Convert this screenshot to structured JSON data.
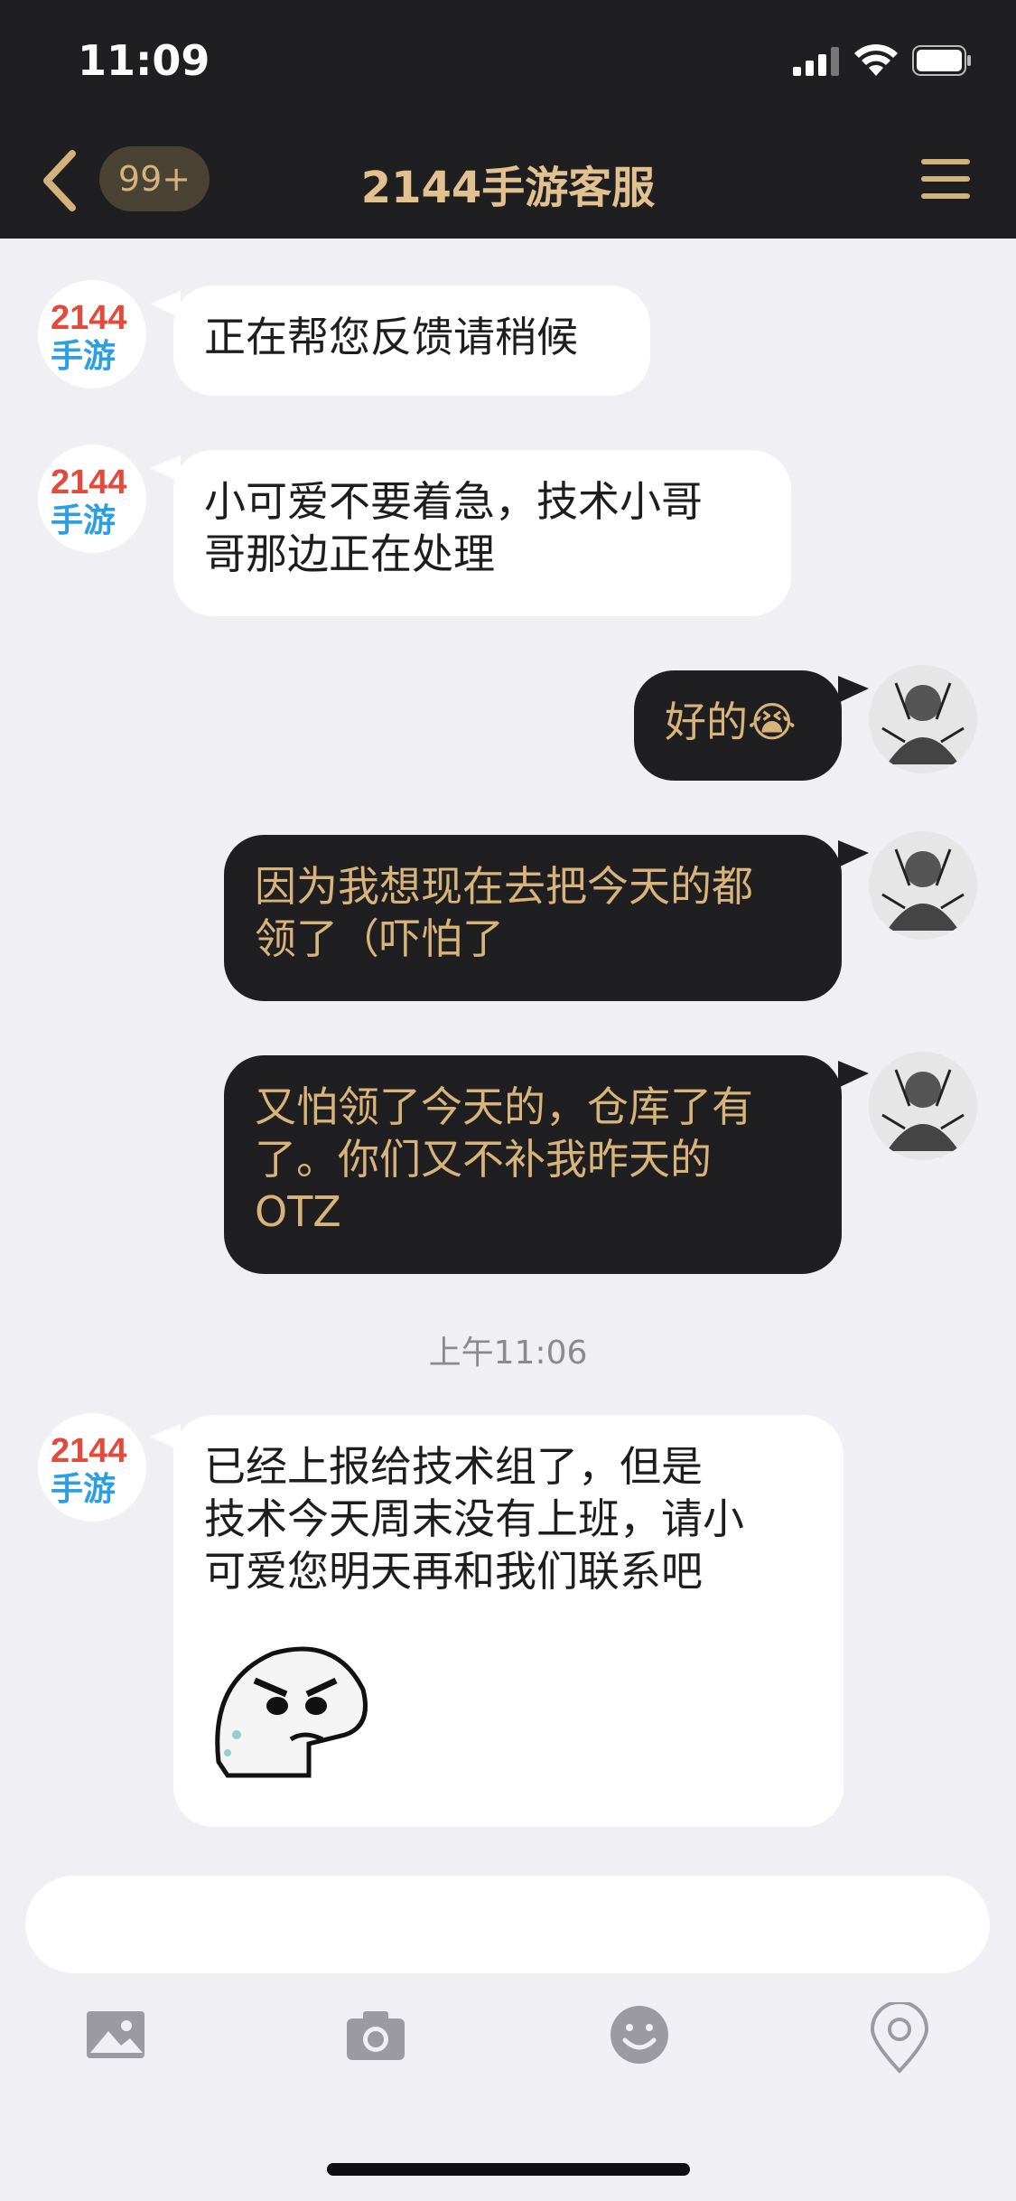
{
  "status_bar": {
    "time": "11:09"
  },
  "nav": {
    "badge": "99+",
    "title": "2144手游客服"
  },
  "brand": {
    "logo_top": "2144",
    "logo_bottom": "手游"
  },
  "messages": [
    {
      "side": "in",
      "text": "正在帮您反馈请稍候"
    },
    {
      "side": "in",
      "text_lines": [
        "小可爱不要着急，技术小哥",
        "哥那边正在处理"
      ]
    },
    {
      "side": "out",
      "text": "好的",
      "emoji": "😭"
    },
    {
      "side": "out",
      "text_lines": [
        "因为我想现在去把今天的都",
        "领了（吓怕了"
      ]
    },
    {
      "side": "out",
      "text_lines": [
        "又怕领了今天的，仓库了有",
        "了。你们又不补我昨天的",
        "OTZ"
      ]
    },
    {
      "side": "in",
      "text_lines": [
        " 已经上报给技术组了，但是",
        "技术今天周末没有上班，请小",
        "可爱您明天再和我们联系吧"
      ],
      "has_sticker": true
    }
  ],
  "timestamp": "上午11:06",
  "input": {
    "value": "",
    "placeholder": ""
  },
  "toolbar": {
    "items": [
      "image-icon",
      "camera-icon",
      "emoji-icon",
      "location-icon"
    ]
  },
  "colors": {
    "dark": "#1f1f22",
    "gold": "#d8b37a",
    "background": "#efeff4"
  }
}
